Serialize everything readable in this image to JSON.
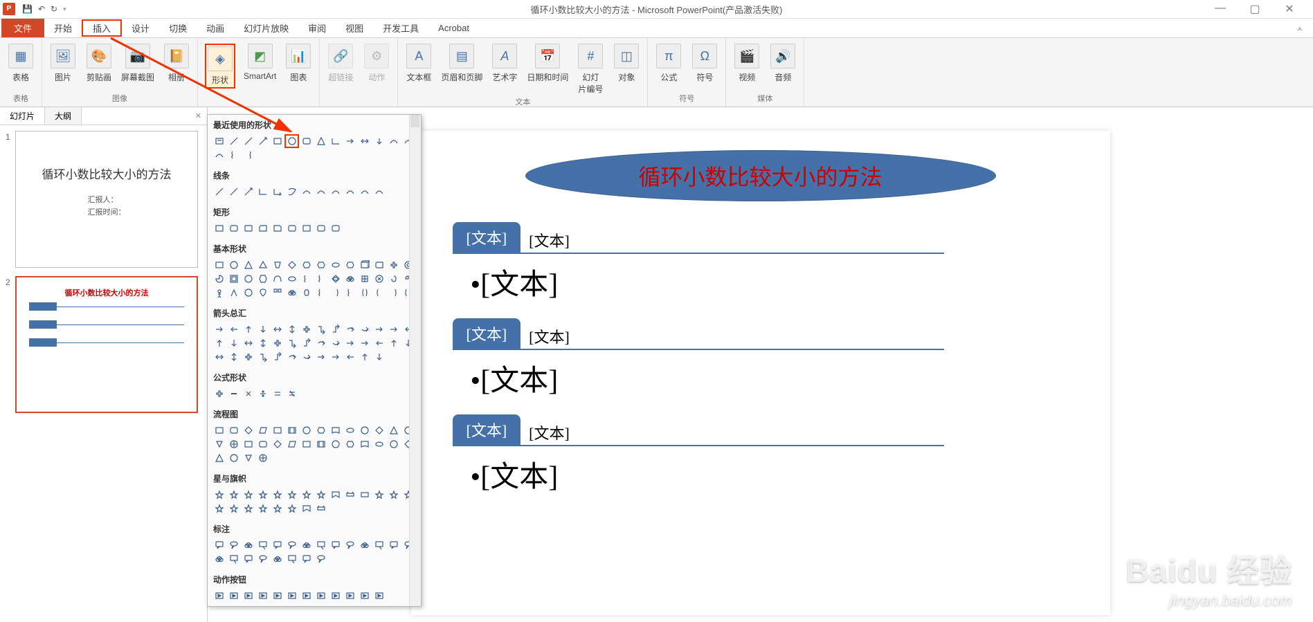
{
  "titlebar": {
    "app_letter": "P",
    "title": "循环小数比较大小的方法 - Microsoft PowerPoint(产品激活失败)"
  },
  "tabs": {
    "file": "文件",
    "home": "开始",
    "insert": "插入",
    "design": "设计",
    "transitions": "切换",
    "animations": "动画",
    "slideshow": "幻灯片放映",
    "review": "审阅",
    "view": "视图",
    "developer": "开发工具",
    "acrobat": "Acrobat"
  },
  "ribbon": {
    "groups": {
      "tables": {
        "label": "表格",
        "ctl_table": "表格"
      },
      "images": {
        "label": "图像",
        "ctl_picture": "图片",
        "ctl_clipart": "剪贴画",
        "ctl_screenshot": "屏幕截图",
        "ctl_album": "相册"
      },
      "illustrations": {
        "ctl_shapes": "形状",
        "ctl_smartart": "SmartArt",
        "ctl_chart": "图表"
      },
      "links": {
        "ctl_hyperlink": "超链接",
        "ctl_action": "动作"
      },
      "text": {
        "label": "文本",
        "ctl_textbox": "文本框",
        "ctl_headerfooter": "页眉和页脚",
        "ctl_wordart": "艺术字",
        "ctl_datetime": "日期和时间",
        "ctl_slidenum": "幻灯\n片编号",
        "ctl_object": "对象"
      },
      "symbols": {
        "label": "符号",
        "ctl_equation": "公式",
        "ctl_symbol": "符号"
      },
      "media": {
        "label": "媒体",
        "ctl_video": "视频",
        "ctl_audio": "音频"
      }
    }
  },
  "left_panel": {
    "tab_slides": "幻灯片",
    "tab_outline": "大纲",
    "thumb1": {
      "title": "循环小数比较大小的方法",
      "sub1": "汇报人：",
      "sub2": "汇报时间："
    },
    "thumb2": {
      "title": "循环小数比较大小的方法"
    }
  },
  "slide": {
    "title": "循环小数比较大小的方法",
    "block_tag": "[文本]",
    "block_sub": "[文本]",
    "block_body": "•[文本]"
  },
  "shapes_dropdown": {
    "sections": {
      "recent": "最近使用的形状",
      "lines": "线条",
      "rectangles": "矩形",
      "basic": "基本形状",
      "arrows": "箭头总汇",
      "equation": "公式形状",
      "flowchart": "流程图",
      "stars": "星与旗帜",
      "callouts": "标注",
      "actions": "动作按钮"
    }
  },
  "watermark": {
    "main": "Baidu 经验",
    "sub": "jingyan.baidu.com"
  }
}
